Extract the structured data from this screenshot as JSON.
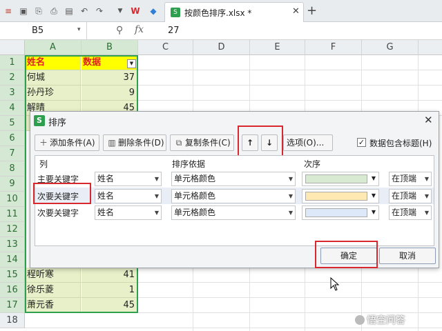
{
  "titlebar": {
    "tab_name": "按颜色排序.xlsx *",
    "tab_close": "✕",
    "new_tab": "+"
  },
  "formula_bar": {
    "name_box": "B5",
    "fx": "fx",
    "value": "27"
  },
  "columns": [
    "A",
    "B",
    "C",
    "D",
    "E",
    "F",
    "G"
  ],
  "rows": [
    "1",
    "2",
    "3",
    "4",
    "5",
    "6",
    "7",
    "8",
    "9",
    "10",
    "11",
    "12",
    "13",
    "14",
    "15",
    "16",
    "17",
    "18"
  ],
  "sheet": {
    "header": {
      "a": "姓名",
      "b": "数据"
    },
    "visible_rows": [
      {
        "row": 2,
        "a": "何城",
        "b": "37"
      },
      {
        "row": 3,
        "a": "孙丹珍",
        "b": "9"
      },
      {
        "row": 4,
        "a": "解晴",
        "b": "45"
      },
      {
        "row": 15,
        "a": "程听寒",
        "b": "41"
      },
      {
        "row": 16,
        "a": "徐乐菱",
        "b": "1"
      },
      {
        "row": 17,
        "a": "萧元香",
        "b": "45"
      }
    ]
  },
  "dialog": {
    "title": "排序",
    "close": "✕",
    "add_condition": "添加条件(A)",
    "delete_condition": "删除条件(D)",
    "copy_condition": "复制条件(C)",
    "move_up": "↑",
    "move_down": "↓",
    "options": "选项(O)...",
    "has_header_label": "数据包含标题(H)",
    "has_header_checked": true,
    "col_header": "列",
    "basis_header": "排序依据",
    "order_header": "次序",
    "levels": [
      {
        "label": "主要关键字",
        "column": "姓名",
        "basis": "单元格颜色",
        "color": "#d9ead3",
        "order": "在顶端"
      },
      {
        "label": "次要关键字",
        "column": "姓名",
        "basis": "单元格颜色",
        "color": "#ffe9b3",
        "order": "在顶端"
      },
      {
        "label": "次要关键字",
        "column": "姓名",
        "basis": "单元格颜色",
        "color": "#dde9f8",
        "order": "在顶端"
      }
    ],
    "ok": "确定",
    "cancel": "取消"
  },
  "watermark": "悟空问答",
  "colors": {
    "accent_green": "#2e9e4f",
    "annotation_red": "#d9272e",
    "header_yellow": "#ffff00"
  }
}
